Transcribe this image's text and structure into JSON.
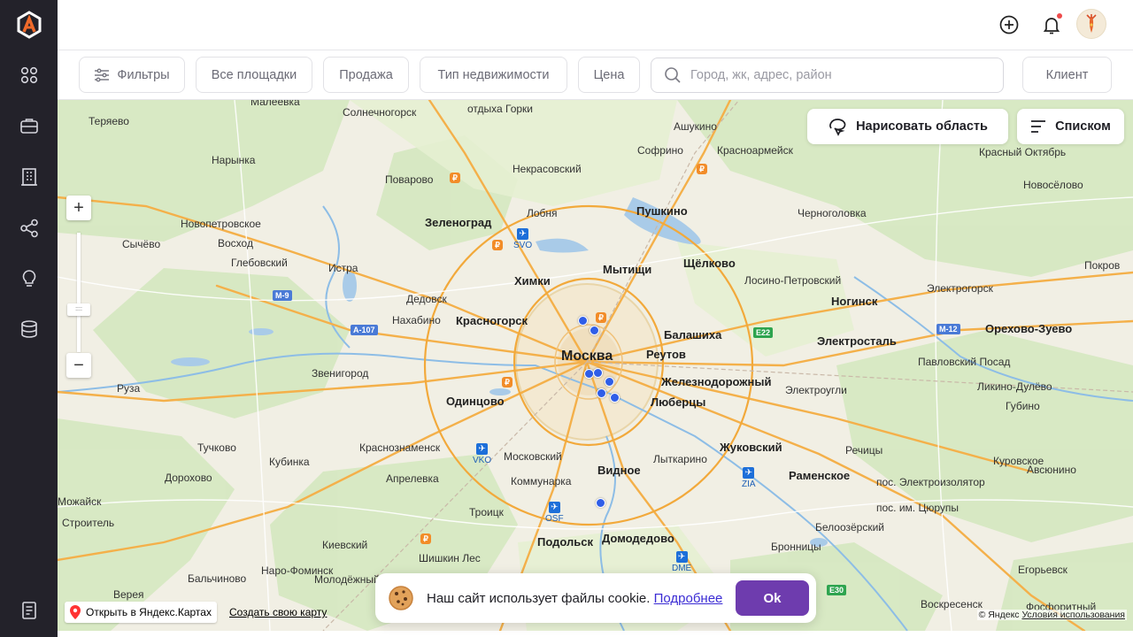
{
  "sidebar": {
    "logo": "brand-logo",
    "items": [
      {
        "icon": "dashboard-grid-icon"
      },
      {
        "icon": "briefcase-icon"
      },
      {
        "icon": "building-icon"
      },
      {
        "icon": "share-network-icon"
      },
      {
        "icon": "lightbulb-icon"
      },
      {
        "icon": "database-icon"
      },
      {
        "icon": "document-icon"
      }
    ]
  },
  "topbar": {
    "add_icon": "plus-circle-icon",
    "bell_icon": "bell-icon",
    "avatar_icon": "avatar-icon"
  },
  "filters": {
    "filters_label": "Фильтры",
    "all_sites_label": "Все площадки",
    "deal_label": "Продажа",
    "property_type_label": "Тип недвижимости",
    "price_label": "Цена",
    "search_placeholder": "Город, жк, адрес, район",
    "client_label": "Клиент"
  },
  "map": {
    "draw_area_label": "Нарисовать область",
    "list_label": "Списком",
    "open_yandex_label": "Открыть в Яндекс.Картах",
    "create_map_label": "Создать свою карту",
    "copyright_label": "© Яндекс",
    "terms_label": "Условия использования",
    "cities": {
      "moskva": "Москва",
      "zelenograd": "Зеленоград",
      "khimki": "Химки",
      "mytishchi": "Мытищи",
      "shchelkovo": "Щёлково",
      "pushkino": "Пушкино",
      "balashikha": "Балашиха",
      "reutov": "Реутов",
      "zheleznodorozhny": "Железнодорожный",
      "lyubertsy": "Люберцы",
      "zhukovsky": "Жуковский",
      "ramenskoe": "Раменское",
      "vidnoe": "Видное",
      "domodedovo": "Домодедово",
      "podolsk": "Подольск",
      "odintsovo": "Одинцово",
      "krasnogorsk": "Красногорск",
      "noginsk": "Ногинск",
      "elektrostal": "Электросталь",
      "orekhovo": "Орехово-Зуево",
      "solnechnogorsk": "Солнечногорск",
      "lobnya": "Лобня",
      "dedovsk": "Дедовск",
      "nakhabino": "Нахабино",
      "istra": "Истра",
      "zvenigorod": "Звенигород",
      "ruza": "Руза",
      "krasnoznamensk": "Краснознаменск",
      "moskovsky": "Московский",
      "kommunarka": "Коммунарка",
      "troitsk": "Троицк",
      "lytkarino": "Лыткарино",
      "sofrino": "Софрино",
      "krasnoarmeysk": "Красноармейск",
      "chernogolovka": "Черноголовка",
      "losino": "Лосино-Петровский",
      "elektrogorsk": "Электрогорск",
      "pokrov": "Покров",
      "pavlovsky_posad": "Павловский Посад",
      "elektrougli": "Электроугли",
      "likino": "Ликино-Дулёво",
      "kurovskoe": "Куровское",
      "bronnitsy": "Бронницы",
      "voskresensk": "Воскресенск",
      "kubinka": "Кубинка",
      "aprelevka": "Апрелевка",
      "tuchkovo": "Тучково",
      "nekrasovsky": "Некрасовский",
      "ashukino": "Ашукино",
      "naro": "Наро-Фоминск",
      "kievsky": "Киевский",
      "belooziorsky": "Белоозёрский",
      "egorievsk": "Егорьевск",
      "novoselovo": "Новосёлово",
      "krasny_oktyabr": "Красный Октябрь",
      "gubino": "Губино",
      "avsyunino": "Авсюнино",
      "rechitsy": "Речицы",
      "elektroizolyator": "пос. Электроизолятор",
      "tsyurupy": "пос. им. Цюрупы",
      "narynka": "Нарынка",
      "teryaevo": "Теряево",
      "povarovo": "Поварово",
      "novopetrovskoe": "Новопетровское",
      "voskhod": "Восход",
      "sychevo": "Сычёво",
      "glebovsky": "Глебовский",
      "dorokhovo": "Дорохово",
      "mozhaysk": "Можайск",
      "stroitel": "Строитель",
      "verya": "Верея",
      "baltchinovo": "Бальчиново",
      "moldovskoe": "Молодёжный",
      "shishkin_les": "Шишкин Лес",
      "fosforitny": "Фосфоритный",
      "otdykha_gorki": "отдыха Горки",
      "maleevka": "Малеевка"
    },
    "airports": {
      "svo": "SVO",
      "vko": "VKO",
      "dme": "DME",
      "zia": "ZIA",
      "osf": "OSF"
    },
    "roads": {
      "m9": "M-9",
      "a107": "A-107",
      "e22": "E22",
      "m12": "M-12",
      "e30": "E30"
    }
  },
  "cookie": {
    "icon": "cookie-icon",
    "text": "Наш сайт использует файлы cookie.",
    "more_label": "Подробнее",
    "ok_label": "Ok"
  }
}
